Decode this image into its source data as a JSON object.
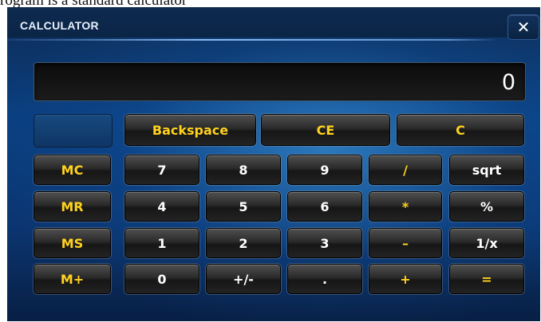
{
  "caption": "rogram is a standard calculator",
  "window": {
    "title": "CALCULATOR",
    "close_glyph": "✕"
  },
  "display": {
    "value": "0"
  },
  "top_row": {
    "backspace": "Backspace",
    "ce": "CE",
    "c": "C"
  },
  "memory": {
    "mc": "MC",
    "mr": "MR",
    "ms": "MS",
    "mplus": "M+"
  },
  "keys": {
    "seven": "7",
    "eight": "8",
    "nine": "9",
    "divide": "/",
    "sqrt": "sqrt",
    "four": "4",
    "five": "5",
    "six": "6",
    "multiply": "*",
    "percent": "%",
    "one": "1",
    "two": "2",
    "three": "3",
    "minus": "–",
    "reciprocal": "1/x",
    "zero": "0",
    "sign": "+/-",
    "decimal": ".",
    "plus": "+",
    "equals": "="
  },
  "colors": {
    "accent_text": "#ffd21e",
    "key_text": "#ffffff",
    "window_bg": "#0a3f80"
  }
}
